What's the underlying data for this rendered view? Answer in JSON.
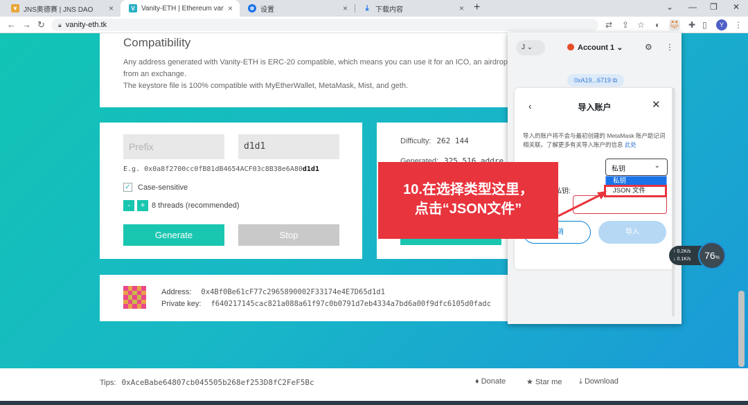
{
  "browser": {
    "tabs": [
      {
        "label": "JNS奥德赛 | JNS DAO",
        "active": false
      },
      {
        "label": "Vanity-ETH | Ethereum vanity a",
        "active": true
      },
      {
        "label": "设置",
        "active": false
      },
      {
        "label": "下载内容",
        "active": false
      }
    ],
    "url": "vanity-eth.tk"
  },
  "compat": {
    "title": "Compatibility",
    "line1": "Any address generated with Vanity-ETH is ERC-20 compatible, which means you can use it for an ICO, an airdrop, o",
    "line2": "from an exchange.",
    "line3": "The keystore file is 100% compatible with MyEtherWallet, MetaMask, Mist, and geth."
  },
  "generator": {
    "prefix_placeholder": "Prefix",
    "suffix_value": "d1d1",
    "example_prefix": "E.g. 0x0a8f2700cc0fB81dB4654ACF03c8B38e6A80",
    "example_suffix": "d1d1",
    "case_sensitive_label": "Case-sensitive",
    "case_sensitive_checked": true,
    "minus": "-",
    "plus": "+",
    "threads_label": "8 threads (recommended)",
    "generate_label": "Generate",
    "stop_label": "Stop"
  },
  "stats": {
    "difficulty_label": "Difficulty:",
    "difficulty_value": "262 144",
    "generated_label": "Generated:",
    "generated_value": "325 516 addre"
  },
  "result": {
    "address_label": "Address:",
    "address_value": "0x4Bf0Be61cF77c2965890002F33174e4E7D65d1d1",
    "private_key_label": "Private key:",
    "private_key_value": "f640217145cac821a088a61f97c0b0791d7eb4334a7bd6a00f9dfc6105d0fadc"
  },
  "footer": {
    "tips_label": "Tips:",
    "tips_address": "0xAceBabe64807cb045505b268ef253D8fC2FeF5Bc",
    "donate": "Donate",
    "star": "Star me",
    "download": "Download"
  },
  "metamask": {
    "network_initial": "J",
    "account_name": "Account 1",
    "address_short": "0xA19...6719",
    "modal_title": "导入账户",
    "info_text": "导入的账户将不会与最初创建的 MetaMask 账户助记词相关联。了解更多有关导入账户的信息",
    "info_link": "此处",
    "select_value": "私钥",
    "options": [
      "私钥",
      "JSON 文件"
    ],
    "pk_label": "私钥:",
    "cancel_label": "取消",
    "import_label": "导入"
  },
  "annotation": {
    "line1": "10.在选择类型这里，",
    "line2": "点击“JSON文件”"
  },
  "speed_widget": {
    "up": "0.2",
    "down": "0.1",
    "unit": "K/s",
    "percent": "76",
    "percent_sign": "%"
  },
  "colors": {
    "accent": "#19c6b0",
    "annotation_red": "#e8343d",
    "metamask_blue": "#037dd6"
  }
}
